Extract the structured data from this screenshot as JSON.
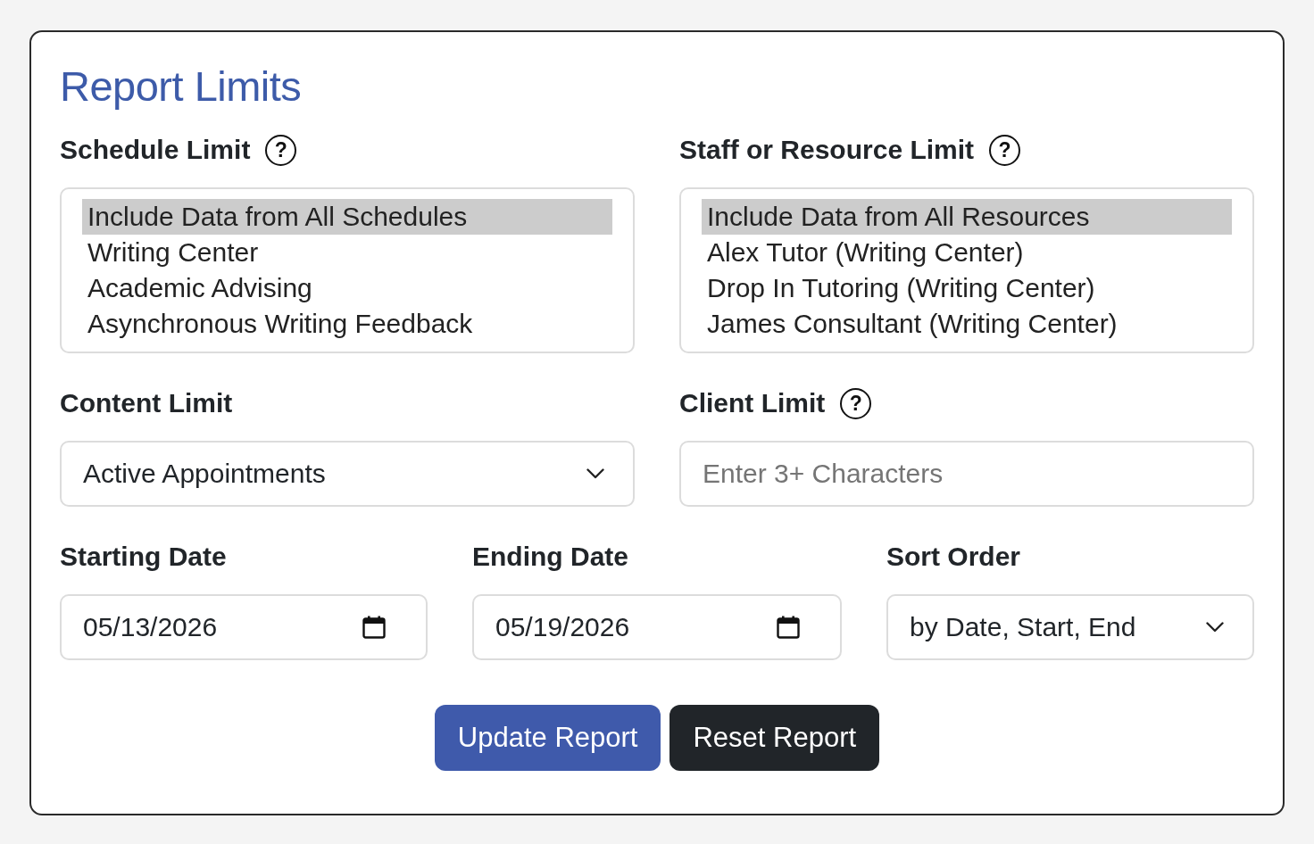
{
  "title": "Report Limits",
  "field_rows": [
    [
      {
        "kind": "listbox",
        "label": "Schedule Limit",
        "help": "?",
        "options": [
          {
            "label": "Include Data from All Schedules",
            "selected": true
          },
          {
            "label": "Writing Center",
            "selected": false
          },
          {
            "label": "Academic Advising",
            "selected": false
          },
          {
            "label": "Asynchronous Writing Feedback",
            "selected": false
          }
        ]
      },
      {
        "kind": "listbox",
        "label": "Staff or Resource Limit",
        "help": "?",
        "options": [
          {
            "label": "Include Data from All Resources",
            "selected": true
          },
          {
            "label": "Alex Tutor (Writing Center)",
            "selected": false
          },
          {
            "label": "Drop In Tutoring (Writing Center)",
            "selected": false
          },
          {
            "label": "James Consultant (Writing Center)",
            "selected": false
          }
        ]
      }
    ],
    [
      {
        "kind": "select",
        "label": "Content Limit",
        "value": "Active Appointments"
      },
      {
        "kind": "text",
        "label": "Client Limit",
        "help": "?",
        "placeholder": "Enter 3+ Characters"
      }
    ],
    [
      {
        "kind": "date",
        "label": "Starting Date",
        "value": "05/13/2026"
      },
      {
        "kind": "date",
        "label": "Ending Date",
        "value": "05/19/2026"
      },
      {
        "kind": "select",
        "label": "Sort Order",
        "value": "by Date, Start, End"
      }
    ]
  ],
  "buttons": [
    {
      "kind": "primary",
      "label": "Update Report"
    },
    {
      "kind": "secondary",
      "label": "Reset Report"
    }
  ]
}
